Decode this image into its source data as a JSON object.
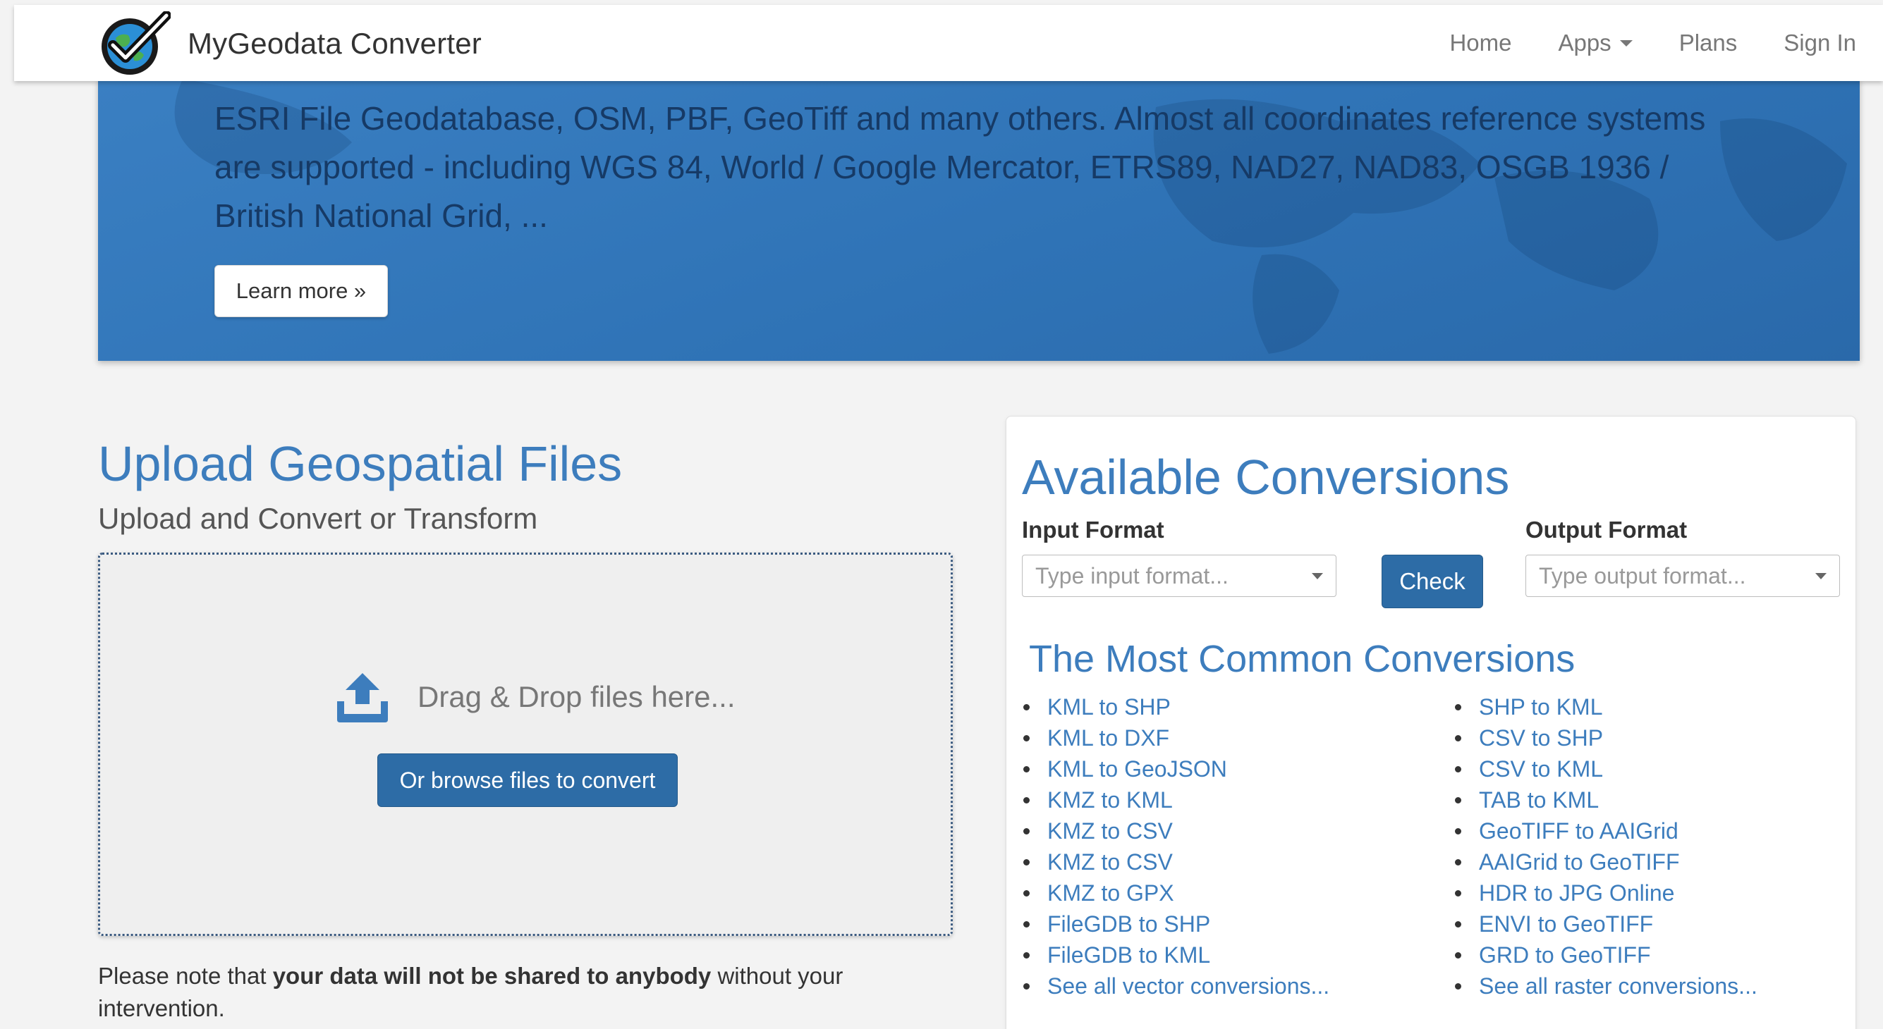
{
  "navbar": {
    "brand": "MyGeodata Converter",
    "items": [
      {
        "label": "Home"
      },
      {
        "label": "Apps"
      },
      {
        "label": "Plans"
      },
      {
        "label": "Sign In"
      }
    ]
  },
  "hero": {
    "text": "ESRI File Geodatabase, OSM, PBF, GeoTiff and many others. Almost all coordinates reference systems are supported - including WGS 84, World / Google Mercator, ETRS89, NAD27, NAD83, OSGB 1936 / British National Grid, ...",
    "learn_more": "Learn more »"
  },
  "upload": {
    "title": "Upload Geospatial Files",
    "subtitle": "Upload and Convert or Transform",
    "drop_text": "Drag & Drop files here...",
    "browse_button": "Or browse files to convert",
    "note_prefix": "Please note that ",
    "note_bold": "your data will not be shared to anybody",
    "note_suffix": " without your intervention."
  },
  "conversions": {
    "title": "Available Conversions",
    "input_label": "Input Format",
    "input_placeholder": "Type input format...",
    "check_button": "Check",
    "output_label": "Output Format",
    "output_placeholder": "Type output format...",
    "common_title": "The Most Common Conversions",
    "left": [
      "KML to SHP",
      "KML to DXF",
      "KML to GeoJSON",
      "KMZ to KML",
      "KMZ to CSV",
      "KMZ to CSV",
      "KMZ to GPX",
      "FileGDB to SHP",
      "FileGDB to KML",
      "See all vector conversions..."
    ],
    "right": [
      "SHP to KML",
      "CSV to SHP",
      "CSV to KML",
      "TAB to KML",
      "GeoTIFF to AAIGrid",
      "AAIGrid to GeoTIFF",
      "HDR to JPG Online",
      "ENVI to GeoTIFF",
      "GRD to GeoTIFF",
      "See all raster conversions..."
    ]
  },
  "colors": {
    "accent": "#3d7dbd",
    "button": "#2d6ca6",
    "hero": "#2f73b6"
  },
  "icons": {
    "logo": "checkmark-globe-logo",
    "upload": "upload-tray-icon",
    "caret": "caret-down-icon"
  }
}
